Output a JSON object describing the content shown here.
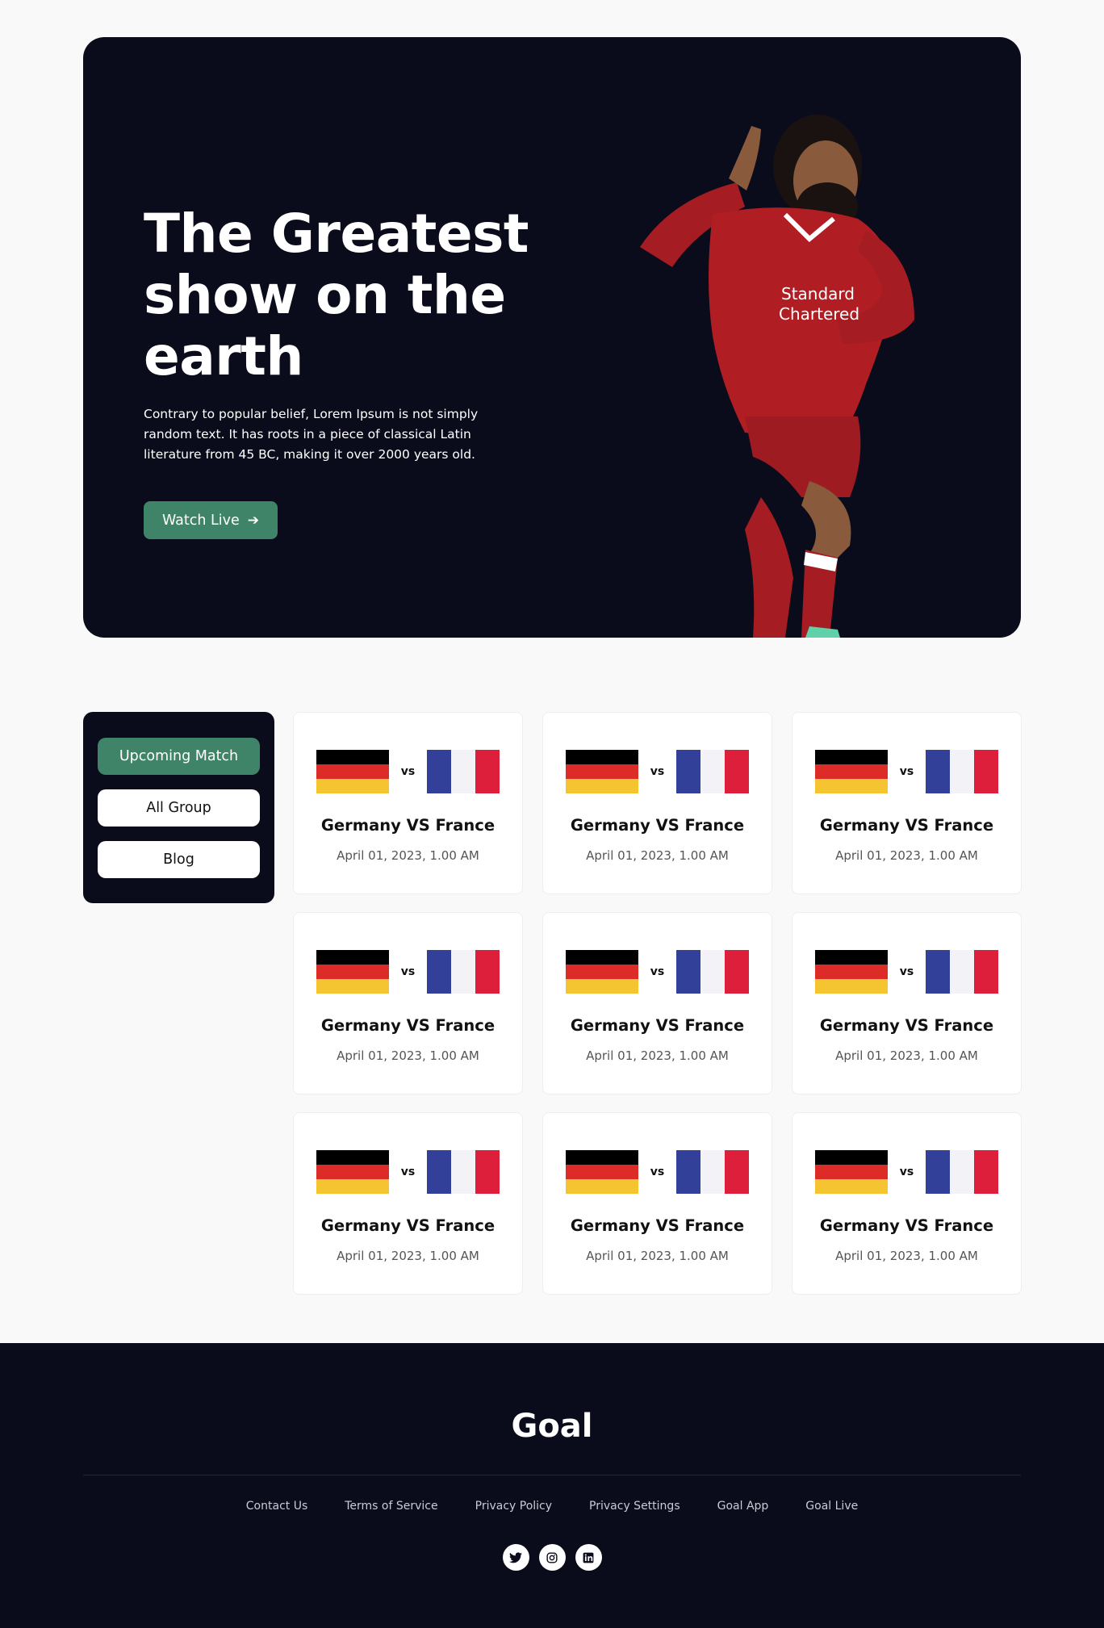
{
  "hero": {
    "title": "The Greatest show on the earth",
    "description": "Contrary to popular belief, Lorem Ipsum is not simply random text. It has roots in a piece of classical Latin literature from 45 BC, making it over 2000 years old.",
    "cta_label": "Watch Live",
    "cta_icon": "arrow-right-icon"
  },
  "sidebar": {
    "items": [
      {
        "label": "Upcoming Match",
        "active": true
      },
      {
        "label": "All Group",
        "active": false
      },
      {
        "label": "Blog",
        "active": false
      }
    ]
  },
  "matches": [
    {
      "title": "Germany VS France",
      "vs": "vs",
      "date": "April 01, 2023, 1.00 AM"
    },
    {
      "title": "Germany VS France",
      "vs": "vs",
      "date": "April 01, 2023, 1.00 AM"
    },
    {
      "title": "Germany VS France",
      "vs": "vs",
      "date": "April 01, 2023, 1.00 AM"
    },
    {
      "title": "Germany VS France",
      "vs": "vs",
      "date": "April 01, 2023, 1.00 AM"
    },
    {
      "title": "Germany VS France",
      "vs": "vs",
      "date": "April 01, 2023, 1.00 AM"
    },
    {
      "title": "Germany VS France",
      "vs": "vs",
      "date": "April 01, 2023, 1.00 AM"
    },
    {
      "title": "Germany VS France",
      "vs": "vs",
      "date": "April 01, 2023, 1.00 AM"
    },
    {
      "title": "Germany VS France",
      "vs": "vs",
      "date": "April 01, 2023, 1.00 AM"
    },
    {
      "title": "Germany VS France",
      "vs": "vs",
      "date": "April 01, 2023, 1.00 AM"
    }
  ],
  "footer": {
    "logo": "Goal",
    "links": [
      "Contact Us",
      "Terms of Service",
      "Privacy Policy",
      "Privacy Settings",
      "Goal App",
      "Goal Live"
    ],
    "socials": [
      "twitter-icon",
      "instagram-icon",
      "linkedin-icon"
    ]
  },
  "colors": {
    "dark": "#0a0c1b",
    "accent": "#3f8468",
    "germany": [
      "#000000",
      "#dd2b27",
      "#f4c531"
    ],
    "france": [
      "#33409a",
      "#f2f2f7",
      "#de1f3b"
    ]
  }
}
